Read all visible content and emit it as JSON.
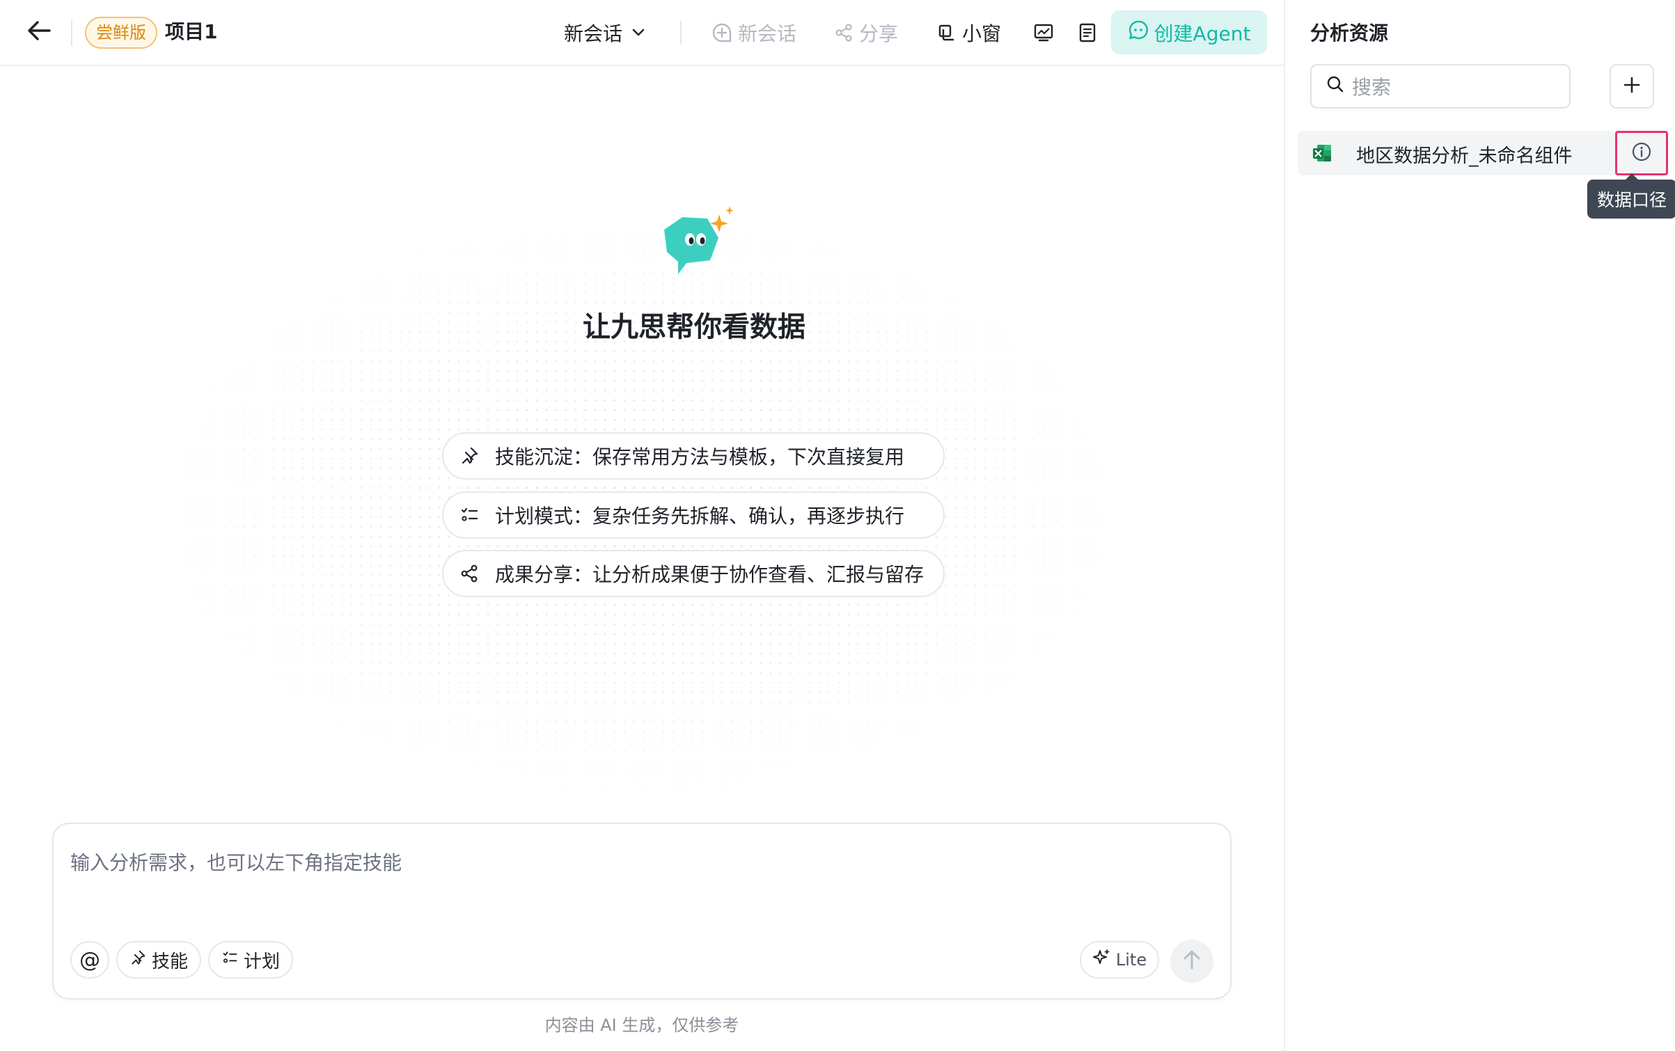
{
  "header": {
    "trial_badge": "尝鲜版",
    "project_name": "项目1",
    "session_select": "新会话",
    "new_session": "新会话",
    "share": "分享",
    "mini_window": "小窗",
    "create_agent": "创建Agent"
  },
  "hero": {
    "title": "让九思帮你看数据",
    "features": [
      "技能沉淀：保存常用方法与模板，下次直接复用",
      "计划模式：复杂任务先拆解、确认，再逐步执行",
      "成果分享：让分析成果便于协作查看、汇报与留存"
    ]
  },
  "composer": {
    "placeholder": "输入分析需求，也可以左下角指定技能",
    "at_symbol": "@",
    "skill_chip": "技能",
    "plan_chip": "计划",
    "mode": "Lite",
    "disclaimer": "内容由 AI 生成，仅供参考"
  },
  "panel": {
    "title": "分析资源",
    "search_placeholder": "搜索",
    "resources": [
      {
        "name": "地区数据分析_未命名组件",
        "icon": "excel-file-icon"
      }
    ],
    "tooltip": "数据口径"
  },
  "colors": {
    "accent": "#14b8a6",
    "accent_bg": "#d9f4f1",
    "badge_border": "#f0c27a",
    "badge_text": "#d98a0b",
    "highlight": "#e8326b",
    "tooltip_bg": "#3f4754"
  }
}
